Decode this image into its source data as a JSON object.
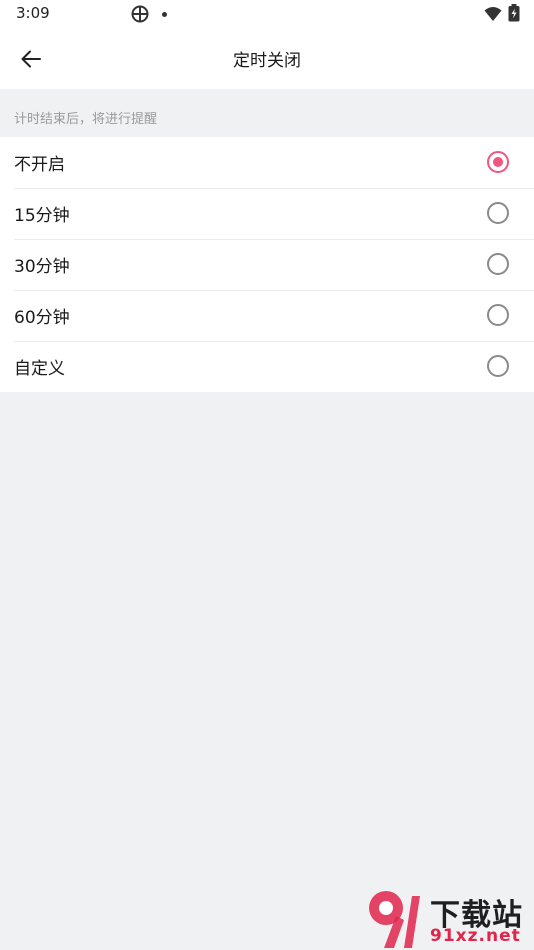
{
  "status_bar": {
    "time": "3:09",
    "icons": [
      "vpn-icon",
      "notification-dot-icon",
      "wifi-icon",
      "battery-charging-icon"
    ]
  },
  "app_bar": {
    "back_icon": "arrow-left-icon",
    "title": "定时关闭"
  },
  "hint": "计时结束后，将进行提醒",
  "options": [
    {
      "label": "不开启",
      "selected": true
    },
    {
      "label": "15分钟",
      "selected": false
    },
    {
      "label": "30分钟",
      "selected": false
    },
    {
      "label": "60分钟",
      "selected": false
    },
    {
      "label": "自定义",
      "selected": false
    }
  ],
  "accent_color": "#f0567f",
  "watermark": {
    "title": "下载站",
    "url": "91xz.net"
  }
}
